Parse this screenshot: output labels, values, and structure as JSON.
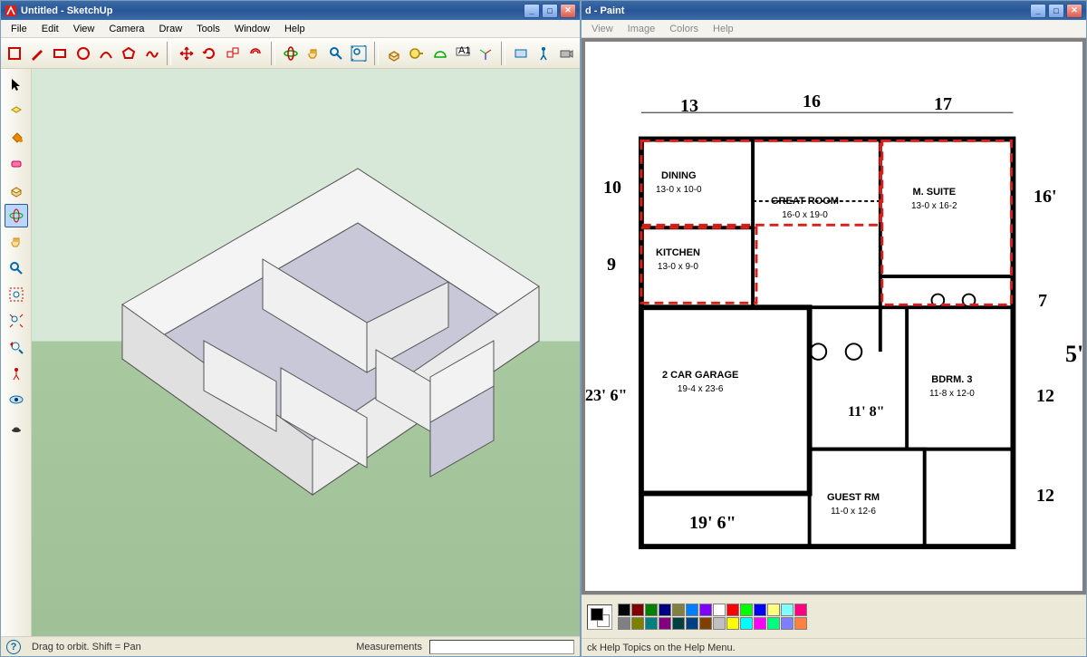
{
  "sketchup": {
    "title": "Untitled - SketchUp",
    "menus": [
      "File",
      "Edit",
      "View",
      "Camera",
      "Draw",
      "Tools",
      "Window",
      "Help"
    ],
    "status": {
      "hint": "Drag to orbit.  Shift = Pan",
      "meas_label": "Measurements"
    },
    "toolbar_icons": [
      "select-rect",
      "pencil",
      "rectangle",
      "circle",
      "arc",
      "polygon",
      "eraser",
      "paint-bucket",
      "move",
      "rotate",
      "scale",
      "offset",
      "orbit",
      "pan",
      "zoom",
      "zoom-extents",
      "push-pull",
      "follow-me",
      "tape",
      "protractor",
      "dimension",
      "text",
      "axes",
      "section",
      "walkaround",
      "camera"
    ],
    "side_icons": [
      "select",
      "paint",
      "info",
      "eraser",
      "push-pull",
      "orbit",
      "pan",
      "zoom",
      "zoom-window",
      "zoom-extents",
      "previous-view",
      "look-around",
      "walk",
      "section-plane",
      "hide"
    ]
  },
  "paint": {
    "title": "d - Paint",
    "menus": [
      "View",
      "Image",
      "Colors",
      "Help"
    ],
    "status": "ck Help Topics on the Help Menu.",
    "palette": [
      "#000000",
      "#808080",
      "#800000",
      "#808000",
      "#008000",
      "#008080",
      "#000080",
      "#800080",
      "#808040",
      "#004040",
      "#0080ff",
      "#004080",
      "#8000ff",
      "#804000",
      "#ffffff",
      "#c0c0c0",
      "#ff0000",
      "#ffff00",
      "#00ff00",
      "#00ffff",
      "#0000ff",
      "#ff00ff",
      "#ffff80",
      "#00ff80",
      "#80ffff",
      "#8080ff",
      "#ff0080",
      "#ff8040"
    ]
  },
  "floorplan": {
    "rooms": {
      "dining": {
        "name": "DINING",
        "dim": "13-0 x 10-0"
      },
      "great": {
        "name": "GREAT ROOM",
        "dim": "16-0 x 19-0"
      },
      "msuite": {
        "name": "M. SUITE",
        "dim": "13-0 x 16-2"
      },
      "kitchen": {
        "name": "KITCHEN",
        "dim": "13-0 x 9-0"
      },
      "garage": {
        "name": "2 CAR GARAGE",
        "dim": "19-4 x 23-6"
      },
      "bdrm3": {
        "name": "BDRM. 3",
        "dim": "11-8 x 12-0"
      },
      "guest": {
        "name": "GUEST RM",
        "dim": "11-0 x 12-6"
      }
    },
    "dims": {
      "top1": "13",
      "top2": "16",
      "top3": "17",
      "left_top": "10",
      "left_mid": "9",
      "left_bot": "23' 6\"",
      "right_16": "16'",
      "right_7": "7",
      "right_12t": "12",
      "right_12b": "12",
      "right_5": "5'",
      "bottom": "19' 6\"",
      "inner_118": "11' 8\""
    }
  }
}
